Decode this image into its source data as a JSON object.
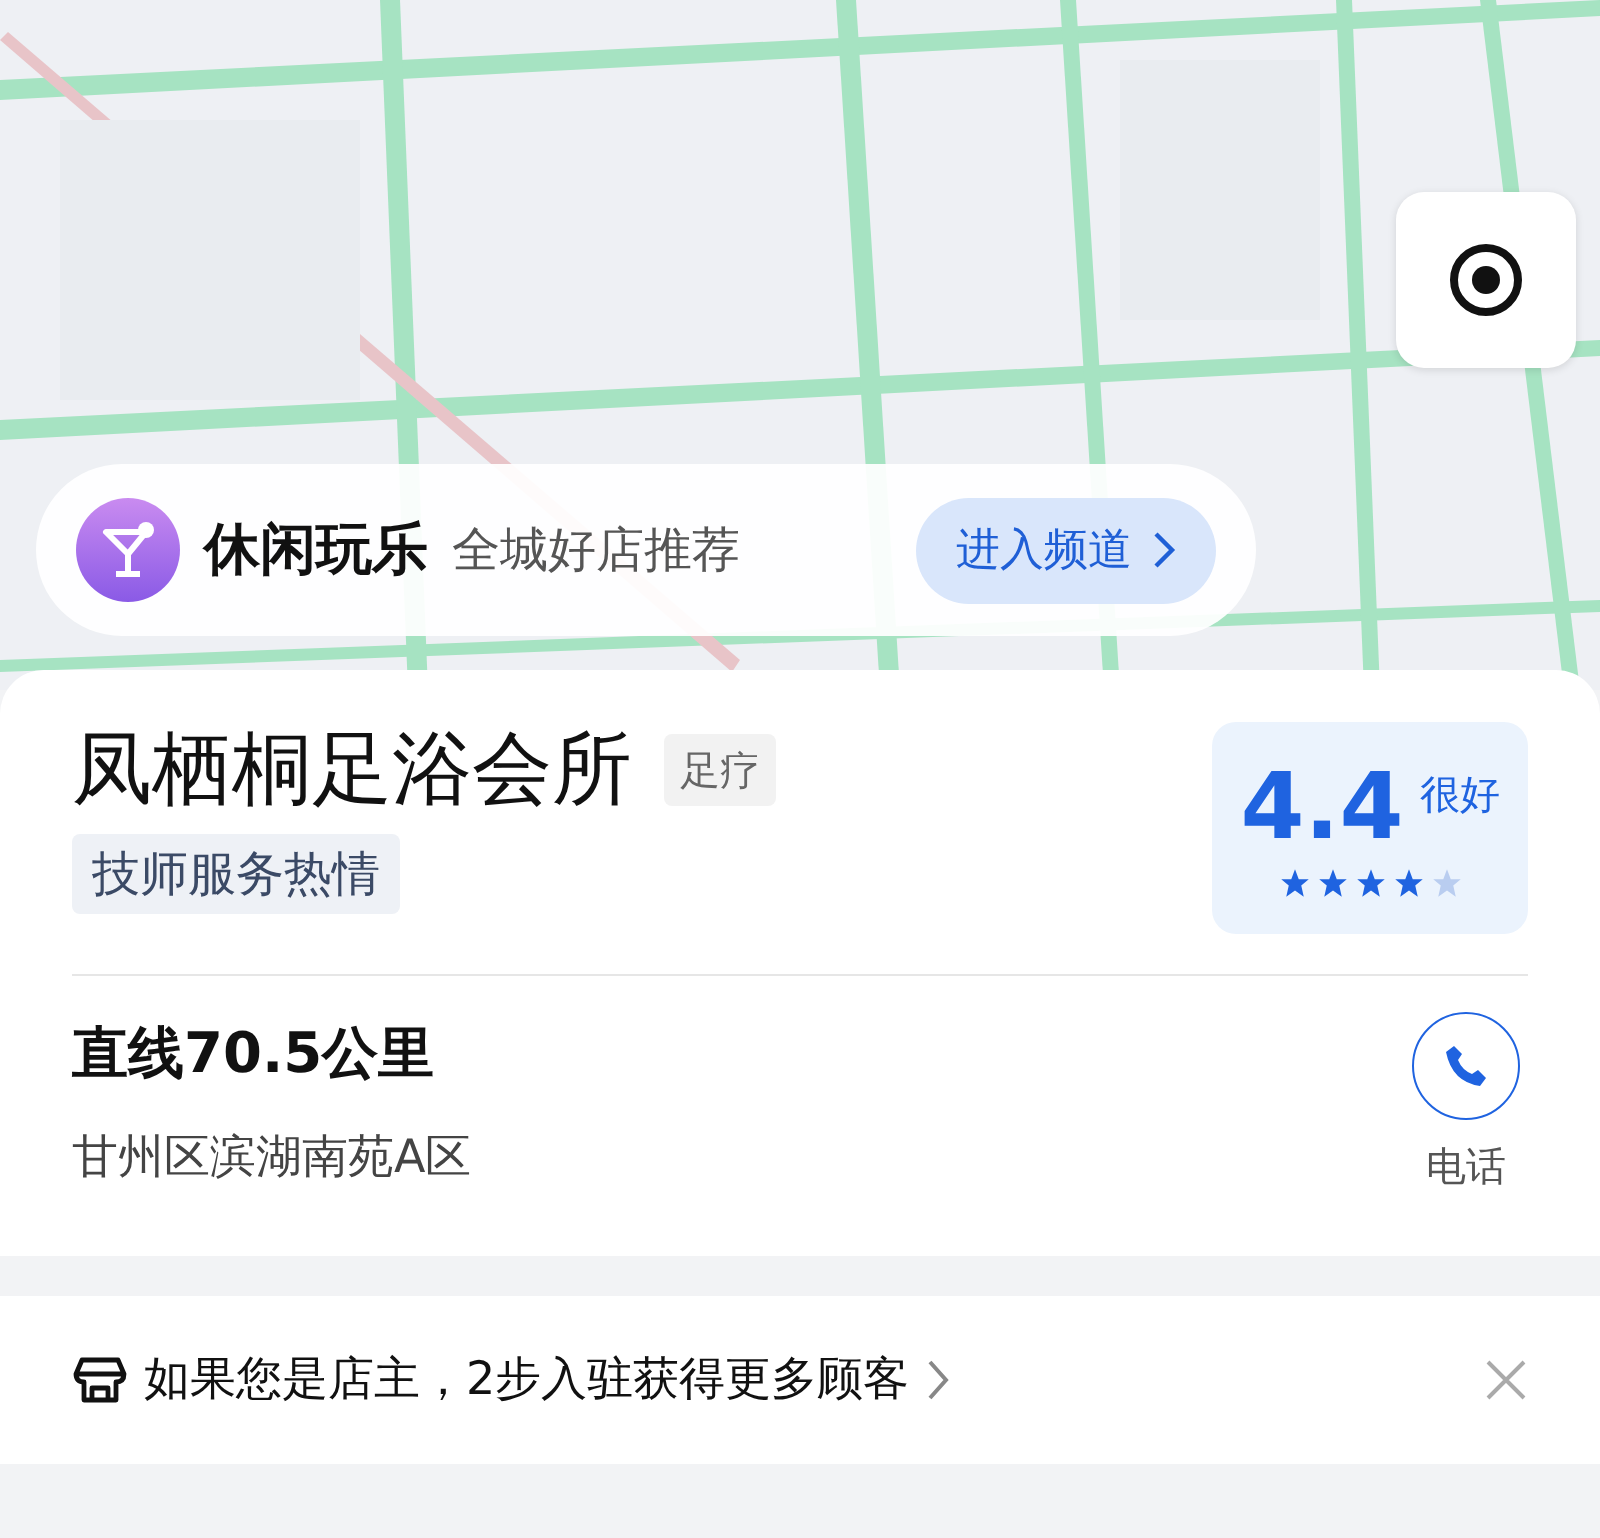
{
  "promo_banner": {
    "title": "休闲玩乐",
    "subtitle": "全城好店推荐",
    "action": "进入频道"
  },
  "shop": {
    "name": "凤栖桐足浴会所",
    "category": "足疗",
    "tags": [
      "技师服务热情"
    ],
    "rating": {
      "score": "4.4",
      "label": "很好",
      "stars": 4
    },
    "distance": "直线70.5公里",
    "address": "甘州区滨湖南苑A区",
    "phone_label": "电话"
  },
  "owner_prompt": {
    "text": "如果您是店主，2步入驻获得更多顾客"
  }
}
